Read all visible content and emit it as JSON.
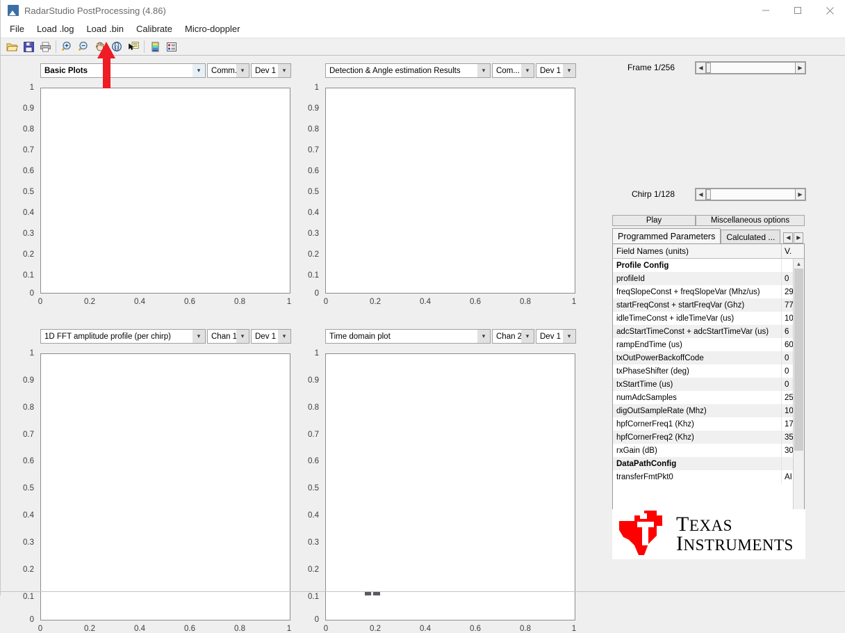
{
  "window": {
    "title": "RadarStudio PostProcessing (4.86)",
    "icon": "matlab-app-icon",
    "minimize": "minimize-icon",
    "maximize": "maximize-icon",
    "close": "close-icon"
  },
  "menu": {
    "items": [
      {
        "label": "File",
        "name": "menu-file"
      },
      {
        "label": "Load .log",
        "name": "menu-load-log"
      },
      {
        "label": "Load .bin",
        "name": "menu-load-bin"
      },
      {
        "label": "Calibrate",
        "name": "menu-calibrate"
      },
      {
        "label": "Micro-doppler",
        "name": "menu-micro-doppler"
      }
    ]
  },
  "toolbar": {
    "items": [
      {
        "name": "open-folder-icon",
        "title": "Open"
      },
      {
        "name": "save-icon",
        "title": "Save"
      },
      {
        "name": "print-icon",
        "title": "Print"
      },
      {
        "name": "zoom-in-icon",
        "title": "Zoom In"
      },
      {
        "name": "zoom-out-icon",
        "title": "Zoom Out"
      },
      {
        "name": "pan-hand-icon",
        "title": "Pan"
      },
      {
        "name": "rotate-3d-icon",
        "title": "Rotate 3D"
      },
      {
        "name": "data-cursor-icon",
        "title": "Data Cursor"
      },
      {
        "name": "colorbar-icon",
        "title": "Insert Colorbar"
      },
      {
        "name": "legend-icon",
        "title": "Insert Legend"
      }
    ]
  },
  "plots": [
    {
      "name": "plot-basic",
      "title": "Basic Plots",
      "title_bold": true,
      "channel": "Comm...",
      "device": "Dev 1",
      "axis": {
        "yticks": [
          "1",
          "0.9",
          "0.8",
          "0.7",
          "0.6",
          "0.5",
          "0.4",
          "0.3",
          "0.2",
          "0.1",
          "0"
        ],
        "xticks": [
          "0",
          "0.2",
          "0.4",
          "0.6",
          "0.8",
          "1"
        ]
      }
    },
    {
      "name": "plot-detection",
      "title": "Detection & Angle estimation Results",
      "title_bold": false,
      "channel": "Com...",
      "device": "Dev 1",
      "axis": {
        "yticks": [
          "1",
          "0.9",
          "0.8",
          "0.7",
          "0.6",
          "0.5",
          "0.4",
          "0.3",
          "0.2",
          "0.1",
          "0"
        ],
        "xticks": [
          "0",
          "0.2",
          "0.4",
          "0.6",
          "0.8",
          "1"
        ]
      }
    },
    {
      "name": "plot-1dfft",
      "title": "1D FFT amplitude profile (per chirp)",
      "title_bold": false,
      "channel": "Chan 1",
      "device": "Dev 1",
      "axis": {
        "yticks": [
          "1",
          "0.9",
          "0.8",
          "0.7",
          "0.6",
          "0.5",
          "0.4",
          "0.3",
          "0.2",
          "0.1",
          "0"
        ],
        "xticks": [
          "0",
          "0.2",
          "0.4",
          "0.6",
          "0.8",
          "1"
        ]
      }
    },
    {
      "name": "plot-timedomain",
      "title": "Time domain plot",
      "title_bold": false,
      "channel": "Chan 2",
      "device": "Dev 1",
      "axis": {
        "yticks": [
          "1",
          "0.9",
          "0.8",
          "0.7",
          "0.6",
          "0.5",
          "0.4",
          "0.3",
          "0.2",
          "0.1",
          "0"
        ],
        "xticks": [
          "0",
          "0.2",
          "0.4",
          "0.6",
          "0.8",
          "1"
        ]
      }
    }
  ],
  "sidebar": {
    "frame_label": "Frame 1/256",
    "chirp_label": "Chirp 1/128",
    "play_button": "Play",
    "misc_button": "Miscellaneous options",
    "tabs": [
      {
        "label": "Programmed Parameters",
        "name": "tab-programmed-parameters",
        "active": true
      },
      {
        "label": "Calculated ...",
        "name": "tab-calculated",
        "active": false
      }
    ],
    "table": {
      "headers": [
        "Field Names    (units)",
        "V."
      ],
      "rows": [
        {
          "field": "Profile Config",
          "value": "",
          "section": true
        },
        {
          "field": "profileId",
          "value": "0"
        },
        {
          "field": "freqSlopeConst + freqSlopeVar (Mhz/us)",
          "value": "29"
        },
        {
          "field": "startFreqConst + startFreqVar (Ghz)",
          "value": "77"
        },
        {
          "field": "idleTimeConst + idleTimeVar (us)",
          "value": "10"
        },
        {
          "field": "adcStartTimeConst + adcStartTimeVar (us)",
          "value": "6"
        },
        {
          "field": "rampEndTime (us)",
          "value": "60"
        },
        {
          "field": "txOutPowerBackoffCode",
          "value": "0"
        },
        {
          "field": "txPhaseShifter (deg)",
          "value": "0"
        },
        {
          "field": "txStartTime (us)",
          "value": "0"
        },
        {
          "field": "numAdcSamples",
          "value": "25"
        },
        {
          "field": "digOutSampleRate (Mhz)",
          "value": "10"
        },
        {
          "field": "hpfCornerFreq1 (Khz)",
          "value": "17"
        },
        {
          "field": "hpfCornerFreq2 (Khz)",
          "value": "35"
        },
        {
          "field": "rxGain (dB)",
          "value": "30"
        },
        {
          "field": "DataPathConfig",
          "value": "",
          "section": true
        },
        {
          "field": "transferFmtPkt0",
          "value": "AI"
        }
      ]
    },
    "logo": {
      "name": "texas-instruments-logo",
      "line1": "EXAS",
      "line1_cap": "T",
      "line2": "NSTRUMENTS",
      "line2_cap": "I"
    }
  },
  "annotation": {
    "name": "red-arrow-annotation",
    "color": "#ee1c25"
  },
  "colors": {
    "accent": "#ee1c25",
    "window_bg": "#efefef",
    "panel_bg": "#ffffff",
    "combo_arrow": "#e8f0f7"
  }
}
